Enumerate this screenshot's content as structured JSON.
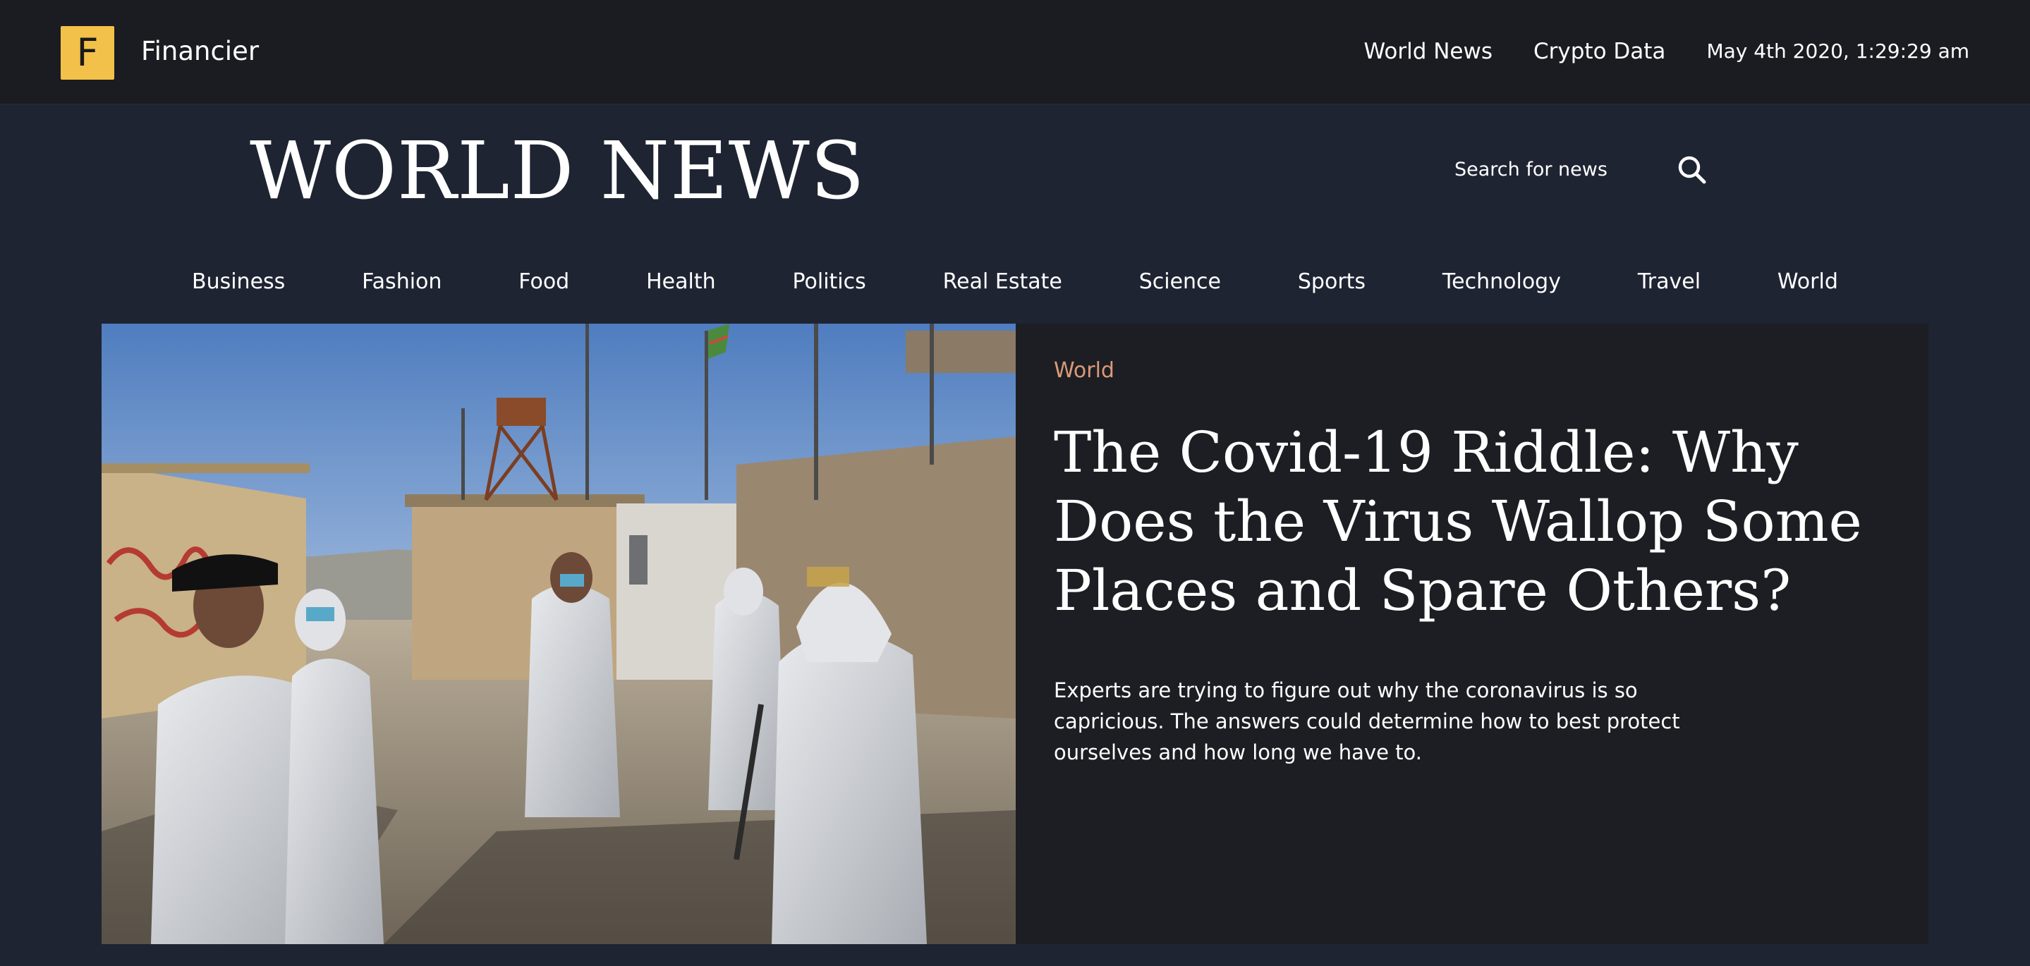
{
  "topbar": {
    "logo_letter": "F",
    "brand": "Financier",
    "links": [
      "World News",
      "Crypto Data"
    ],
    "datetime": "May 4th 2020, 1:29:29 am"
  },
  "masthead": {
    "title": "WORLD NEWS"
  },
  "search": {
    "placeholder": "Search for news",
    "icon": "search-icon"
  },
  "categories": [
    "Business",
    "Fashion",
    "Food",
    "Health",
    "Politics",
    "Real Estate",
    "Science",
    "Sports",
    "Technology",
    "Travel",
    "World"
  ],
  "hero": {
    "category": "World",
    "headline": "The Covid-19 Riddle: Why Does the Virus Wallop Some Places and Spare Others?",
    "summary": "Experts are trying to figure out why the coronavirus is so capricious. The answers could determine how to best protect ourselves and how long we have to.",
    "image_alt": "Health workers in protective suits at a border compound"
  },
  "colors": {
    "accent": "#f2c14a",
    "category": "#d99a7a",
    "background": "#1f2433",
    "topbar": "#1b1c21",
    "card": "#1d1e23"
  }
}
